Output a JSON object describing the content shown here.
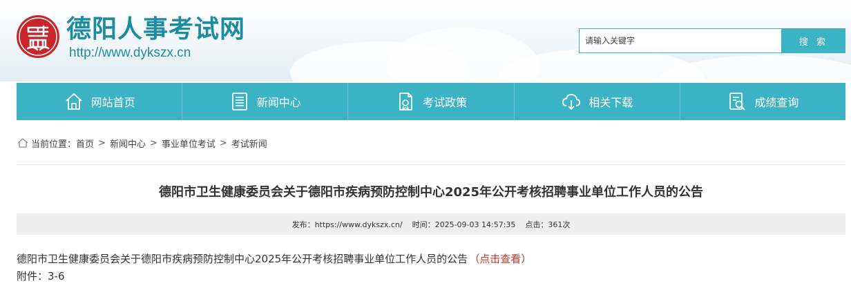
{
  "header": {
    "site_title": "德阳人事考试网",
    "site_url": "http://www.dykszx.cn",
    "logo_icon": "seal-logo-icon",
    "brand_color": "#3cb3c4",
    "seal_color": "#c8262b"
  },
  "search": {
    "placeholder": "请输入关键字",
    "button_label": "搜 索"
  },
  "nav": {
    "items": [
      {
        "label": "网站首页",
        "icon": "home-icon"
      },
      {
        "label": "新闻中心",
        "icon": "news-icon"
      },
      {
        "label": "考试政策",
        "icon": "policy-document-icon"
      },
      {
        "label": "相关下载",
        "icon": "cloud-download-icon"
      },
      {
        "label": "成绩查询",
        "icon": "score-search-icon"
      }
    ]
  },
  "breadcrumb": {
    "prefix": "当前位置：",
    "items": [
      "首页",
      "新闻中心",
      "事业单位考试",
      "考试新闻"
    ],
    "separator": ">"
  },
  "article": {
    "title": "德阳市卫生健康委员会关于德阳市疾病预防控制中心2025年公开考核招聘事业单位工作人员的公告",
    "meta": {
      "publisher": "发布：https://www.dykszx.cn/",
      "time": "时间：2025-09-03 14:57:35",
      "hits": "点击：361次"
    },
    "body_text": "德阳市卫生健康委员会关于德阳市疾病预防控制中心2025年公开考核招聘事业单位工作人员的公告",
    "link_label": "（点击查看）",
    "link_color": "#c0392b",
    "attachment": "附件：3-6"
  }
}
